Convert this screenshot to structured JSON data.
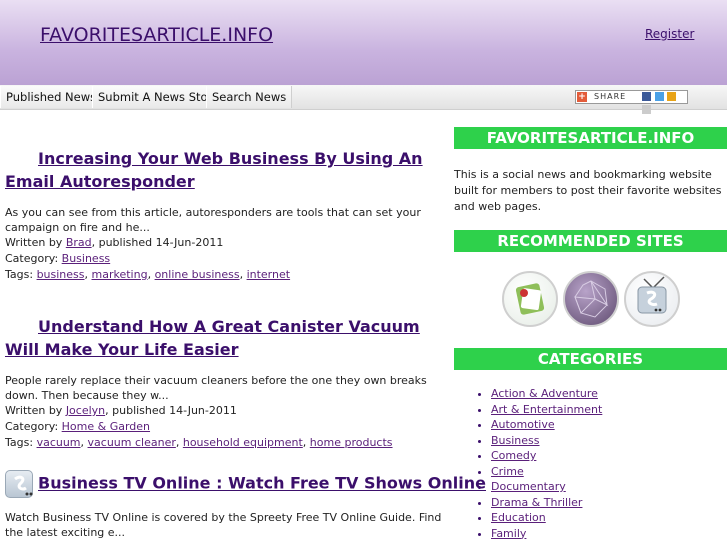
{
  "header": {
    "site_title": "FAVORITESARTICLE.INFO",
    "register": "Register"
  },
  "nav": {
    "items": [
      {
        "label": "Published News"
      },
      {
        "label": "Submit A News Story"
      },
      {
        "label": "Search News"
      }
    ],
    "share_label": "SHARE"
  },
  "articles": [
    {
      "title": "Increasing Your Web Business By Using An Email Autoresponder",
      "summary": "As you can see from this article, autoresponders are tools that can set your campaign on fire and he...",
      "written_by_prefix": "Written by ",
      "author": "Brad",
      "published": ", published 14-Jun-2011",
      "category_prefix": "Category: ",
      "category": "Business",
      "tags_prefix": "Tags: ",
      "tags": [
        "business",
        "marketing",
        "online business",
        "internet"
      ]
    },
    {
      "title": "Understand How A Great Canister Vacuum Will Make Your Life Easier",
      "summary": "People rarely replace their vacuum cleaners before the one they own breaks down. Then because they w...",
      "written_by_prefix": "Written by ",
      "author": "Jocelyn",
      "published": ", published 14-Jun-2011",
      "category_prefix": "Category: ",
      "category": "Home & Garden",
      "tags_prefix": "Tags: ",
      "tags": [
        "vacuum",
        "vacuum cleaner",
        "household equipment",
        "home products"
      ]
    },
    {
      "title": "Business TV Online : Watch Free TV Shows Online",
      "summary": "Watch Business TV Online is covered by the Spreety Free TV Online Guide. Find the latest exciting e..."
    }
  ],
  "sidebar": {
    "site_heading": "FAVORITESARTICLE.INFO",
    "site_text": "This is a social news and bookmarking website built for members to post their favorite websites and web pages.",
    "recommended_heading": "RECOMMENDED SITES",
    "categories_heading": "CATEGORIES",
    "categories": [
      "Action & Adventure",
      "Art & Entertainment",
      "Automotive",
      "Business",
      "Comedy",
      "Crime",
      "Documentary",
      "Drama & Thriller",
      "Education",
      "Family"
    ]
  },
  "colors": {
    "header_top": "#eadff3",
    "header_bottom": "#bba2d4",
    "link": "#3b0f6b",
    "sidebar_heading": "#2ed14b"
  }
}
